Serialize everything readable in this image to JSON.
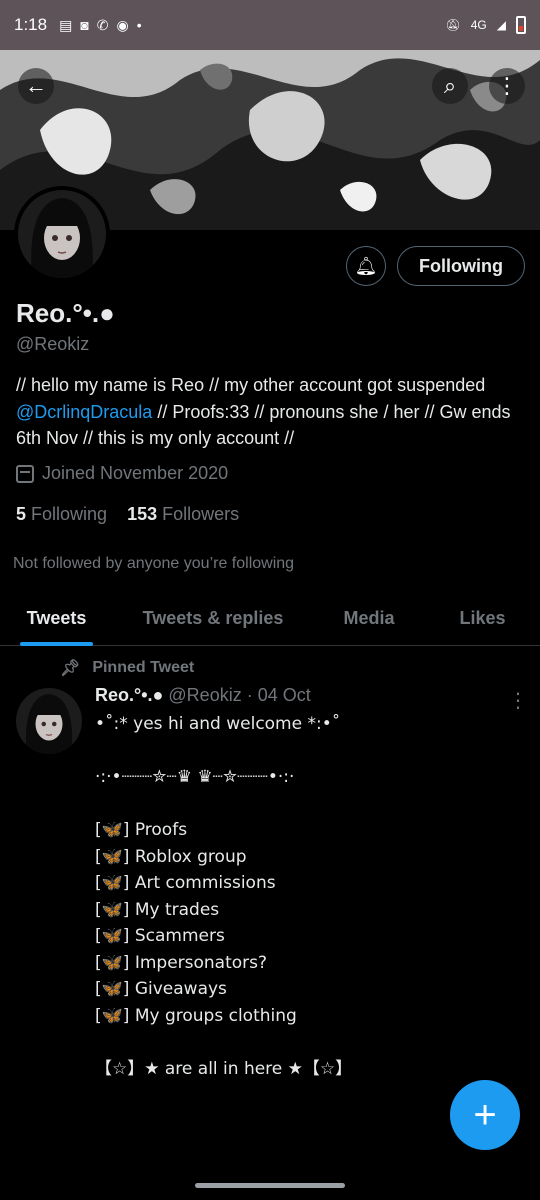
{
  "status_bar": {
    "time": "1:18",
    "network": "4G",
    "left_icons": [
      "message-icon",
      "discord-icon",
      "whatsapp-icon",
      "eye-icon",
      "dot-icon"
    ],
    "right_icons": [
      "mute-icon",
      "signal-icon",
      "battery-icon"
    ]
  },
  "header": {
    "back_icon": "arrow-left-icon",
    "search_icon": "search-icon",
    "more_icon": "more-vertical-icon"
  },
  "profile": {
    "name": "Reo.°•.●",
    "handle": "@Reokiz",
    "bio_part1": "// hello my name is Reo // my other account got suspended ",
    "bio_mention": "@DcrlinqDracula",
    "bio_part2": " // Proofs:33 // pronouns she / her // Gw ends 6th Nov // this is my only account //",
    "joined": "Joined November 2020",
    "following_count": "5",
    "following_label": "Following",
    "followers_count": "153",
    "followers_label": "Followers",
    "not_followed": "Not followed by anyone you’re following",
    "follow_button": "Following"
  },
  "tabs": [
    {
      "label": "Tweets",
      "active": true
    },
    {
      "label": "Tweets & replies",
      "active": false
    },
    {
      "label": "Media",
      "active": false
    },
    {
      "label": "Likes",
      "active": false
    }
  ],
  "tweet": {
    "pinned_label": "Pinned Tweet",
    "author_name": "Reo.°•.●",
    "author_handle": "@Reokiz",
    "date": "· 04 Oct",
    "body": "•˚:* yes hi and welcome *:•˚\n\n·:·•┈┈┈✮┈♛ ♛┈✮┈┈┈•·:·\n\n[🦋] Proofs\n[🦋] Roblox group\n[🦋] Art commissions\n[🦋] My trades\n[🦋] Scammers\n[🦋] Impersonators?\n[🦋] Giveaways\n[🦋] My groups clothing\n\n【☆】★ are all in here ★【☆】"
  },
  "colors": {
    "accent": "#1d9bf0",
    "background": "#000000",
    "secondary_text": "#71767b",
    "status_bar": "#5d5358"
  },
  "fab_icon": "plus-icon"
}
